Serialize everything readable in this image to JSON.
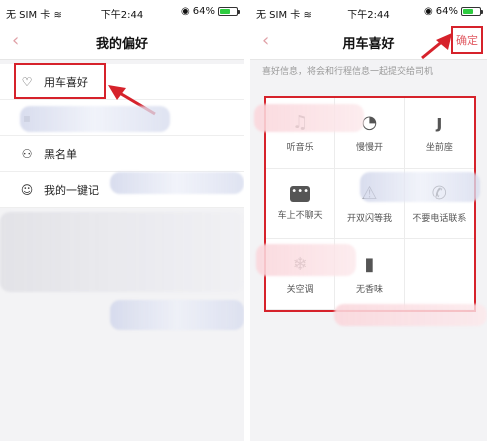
{
  "left": {
    "status": {
      "carrier": "无 SIM 卡",
      "time": "下午2:44",
      "battery": "64%"
    },
    "nav": {
      "back": "‹",
      "title": "我的偏好"
    },
    "items": [
      {
        "label": "用车喜好",
        "icon": "heart-icon"
      },
      {
        "label": "黑名单",
        "icon": "user-block-icon"
      },
      {
        "label": "我的一键记",
        "icon": "smile-icon"
      }
    ]
  },
  "right": {
    "status": {
      "carrier": "无 SIM 卡",
      "time": "下午2:44",
      "battery": "64%"
    },
    "nav": {
      "back": "‹",
      "title": "用车喜好",
      "confirm": "确定"
    },
    "hint": "喜好信息，将会和行程信息一起提交给司机",
    "options": [
      {
        "label": "听音乐",
        "icon": "music-icon"
      },
      {
        "label": "慢慢开",
        "icon": "gauge-icon"
      },
      {
        "label": "坐前座",
        "icon": "seat-icon"
      },
      {
        "label": "车上不聊天",
        "icon": "chat-icon"
      },
      {
        "label": "开双闪等我",
        "icon": "hazard-icon"
      },
      {
        "label": "不要电话联系",
        "icon": "phone-icon"
      },
      {
        "label": "关空调",
        "icon": "ac-icon"
      },
      {
        "label": "无香味",
        "icon": "scent-icon"
      }
    ]
  },
  "colors": {
    "highlight": "#d6222b",
    "accent": "#e15b63",
    "battery": "#2ecc40"
  }
}
